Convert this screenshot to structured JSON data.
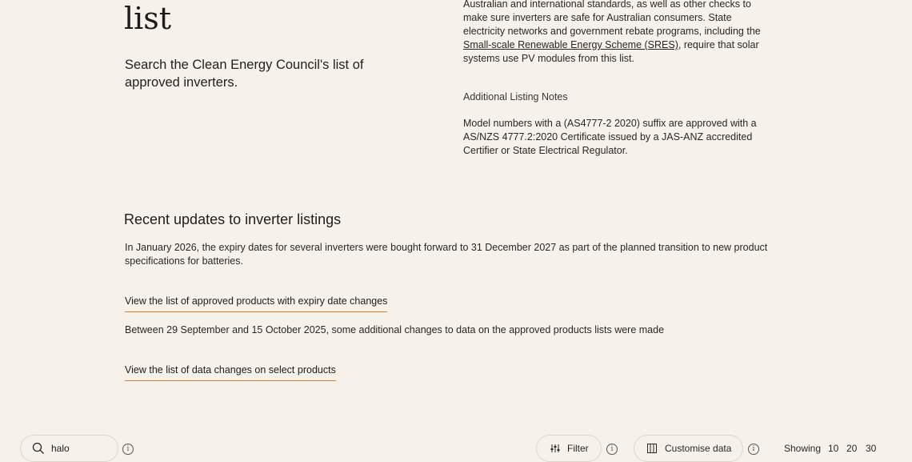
{
  "header": {
    "title_line": "list"
  },
  "intro": {
    "text": "Search the Clean Energy Council's list of approved inverters."
  },
  "right_column": {
    "para_line1": "Australian and international standards, as well as other checks to",
    "para_line2": "make sure inverters are safe for Australian consumers. State",
    "para_line3": "electricity networks and government rebate programs, including the",
    "sres_link": "Small-scale Renewable Energy Scheme (SRES)",
    "para_line4_tail": ", require that solar",
    "para_line5": "systems use PV modules from this list.",
    "notes_heading": "Additional Listing Notes",
    "notes_text": "Model numbers with a (AS4777-2 2020) suffix are approved with a AS/NZS 4777.2:2020 Certificate issued by a JAS-ANZ accredited Certifier or State Electrical Regulator."
  },
  "updates": {
    "heading": "Recent updates to inverter listings",
    "para1": "In January 2026, the expiry dates for several inverters were bought forward to 31 December 2027 as part of the planned transition to new product specifications for batteries.",
    "link1": "View the list of approved products with expiry date changes",
    "para2": "Between 29 September and 15 October 2025, some additional changes to data on the approved products lists were made",
    "link2": "View the list of data changes on select products"
  },
  "toolbar": {
    "search_value": "halo",
    "filter_label": "Filter",
    "customise_label": "Customise data",
    "showing_label": "Showing",
    "page_sizes": [
      "10",
      "20",
      "30"
    ],
    "info_glyph": "i"
  },
  "icons": {
    "search": "search-icon",
    "filter": "sliders-icon",
    "customise": "columns-icon",
    "info": "info-icon"
  },
  "colors": {
    "background": "#f6f2e9",
    "accent_underline": "#e07b2c",
    "text": "#1f1d1a"
  }
}
